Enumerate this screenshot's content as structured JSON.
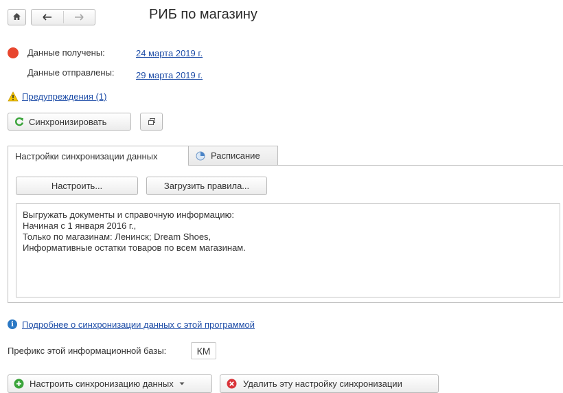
{
  "header": {
    "title": "РИБ по магазину",
    "home_icon": "home-icon",
    "back_icon": "arrow-left-icon",
    "forward_icon": "arrow-right-icon"
  },
  "status": {
    "received_label": "Данные получены:",
    "received_date": "24 марта 2019 г.",
    "sent_label": "Данные отправлены:",
    "sent_date": "29 марта 2019 г.",
    "status_color": "#e8462e",
    "warnings_link": "Предупреждения (1)"
  },
  "toolbar": {
    "sync_label": "Синхронизировать",
    "open_window_icon": "open-window-icon"
  },
  "tabs": [
    {
      "label": "Настройки синхронизации данных",
      "active": true
    },
    {
      "label": "Расписание",
      "active": false
    }
  ],
  "settings": {
    "configure_label": "Настроить...",
    "load_rules_label": "Загрузить правила...",
    "description_lines": [
      "Выгружать документы и справочную информацию:",
      "Начиная с 1 января 2016 г.,",
      "Только по магазинам: Ленинск; Dream Shoes,",
      "Информативные остатки товаров по всем магазинам."
    ]
  },
  "info": {
    "more_link": "Подробнее о синхронизации данных с этой программой",
    "prefix_label": "Префикс этой информационной базы:",
    "prefix_value": "КМ"
  },
  "bottom": {
    "setup_sync_label": "Настроить синхронизацию данных",
    "delete_setting_label": "Удалить эту настройку синхронизации"
  },
  "colors": {
    "link": "#1f4ea8",
    "add_green": "#3aa43a",
    "delete_red": "#d9343a",
    "info_blue": "#2b78c4",
    "warning_yellow": "#f2c500"
  }
}
